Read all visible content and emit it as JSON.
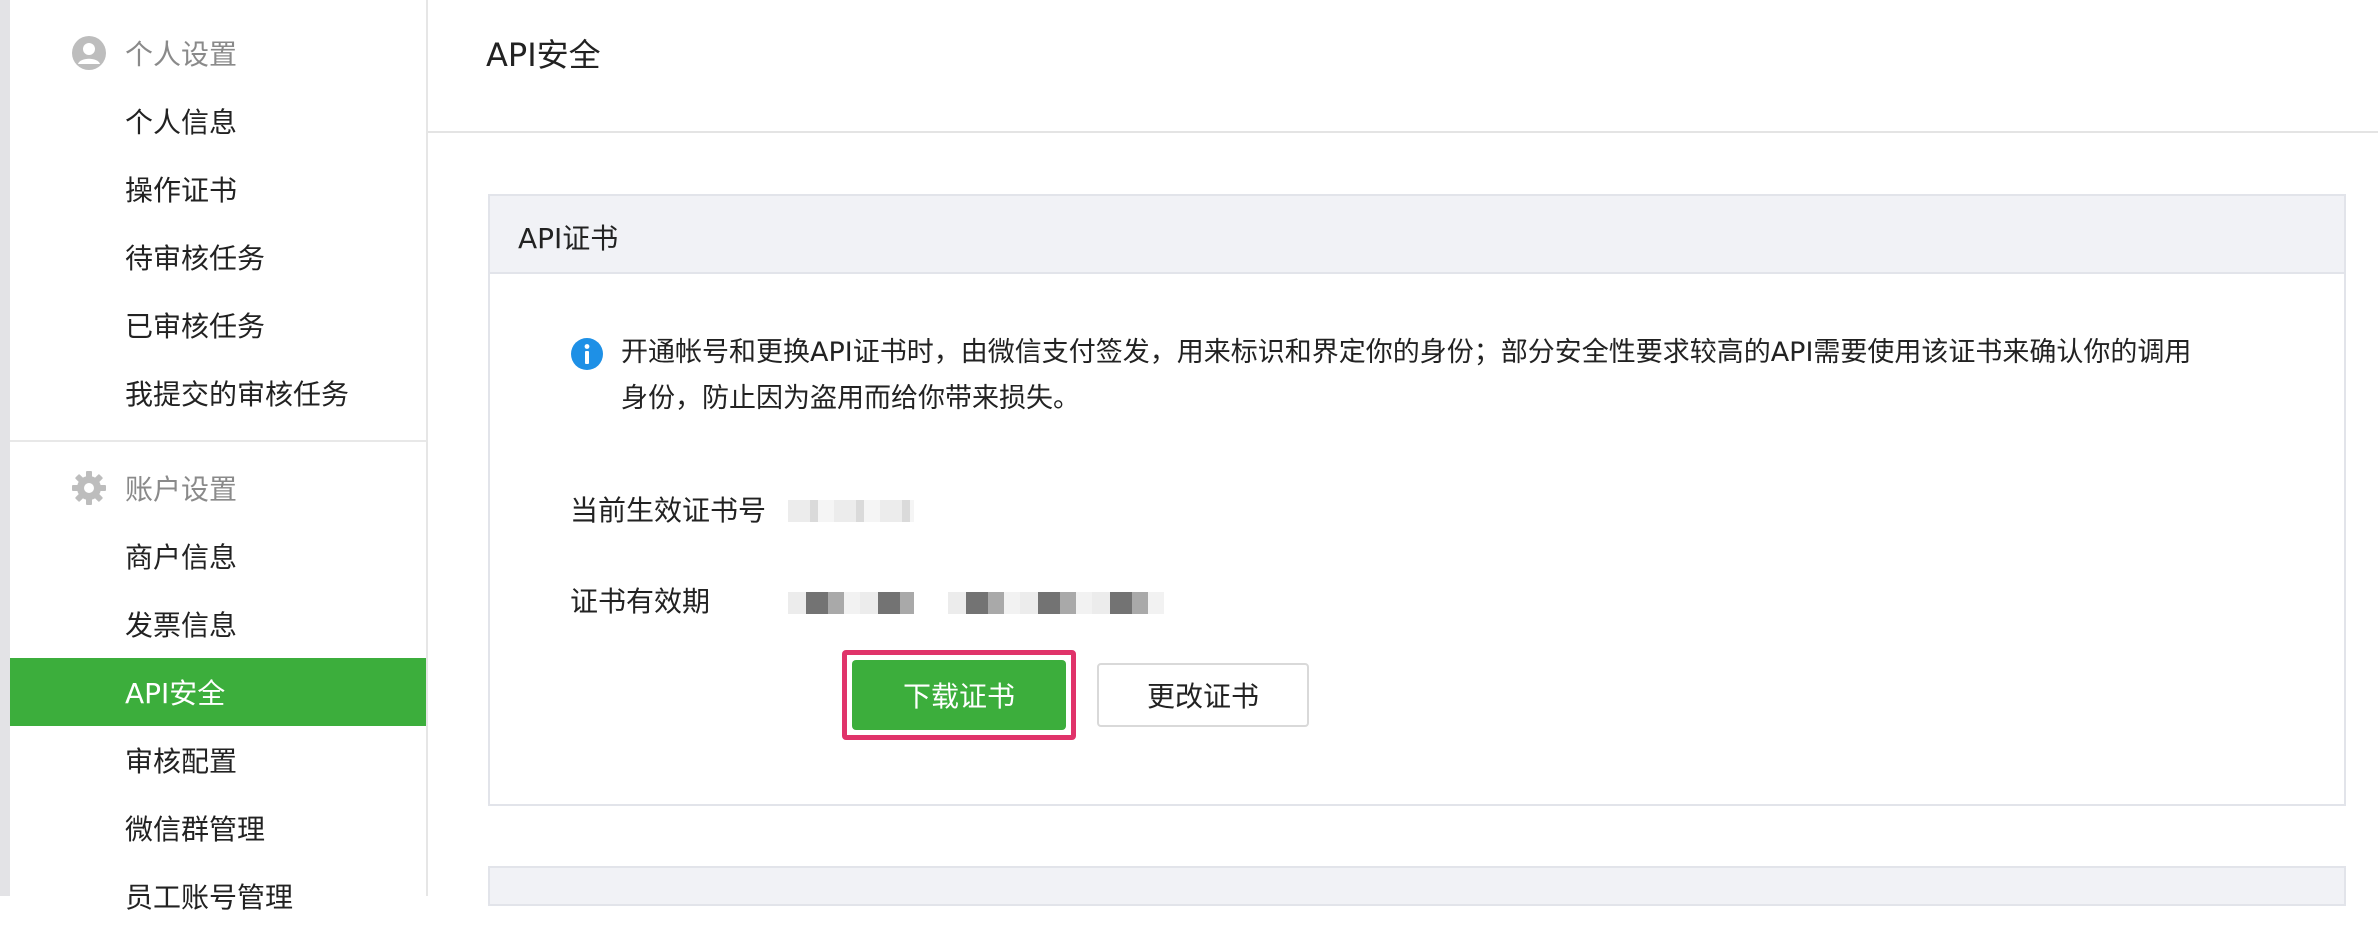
{
  "sidebar": {
    "groups": [
      {
        "icon": "user-icon",
        "label": "个人设置",
        "items": [
          {
            "label": "个人信息"
          },
          {
            "label": "操作证书"
          },
          {
            "label": "待审核任务"
          },
          {
            "label": "已审核任务"
          },
          {
            "label": "我提交的审核任务"
          }
        ]
      },
      {
        "icon": "gear-icon",
        "label": "账户设置",
        "items": [
          {
            "label": "商户信息"
          },
          {
            "label": "发票信息"
          },
          {
            "label": "API安全",
            "active": true
          },
          {
            "label": "审核配置"
          },
          {
            "label": "微信群管理"
          },
          {
            "label": "员工账号管理"
          }
        ]
      }
    ]
  },
  "main": {
    "page_title": "API安全",
    "card": {
      "title": "API证书",
      "info_icon": "info-icon",
      "info_line1": "开通帐号和更换API证书时，由微信支付签发，用来标识和界定你的身份；部分安全性要求较高的API需要使用该证书来确认你的调用",
      "info_line2": "身份，防止因为盗用而给你带来损失。",
      "fields": [
        {
          "label": "当前生效证书号"
        },
        {
          "label": "证书有效期"
        }
      ],
      "buttons": {
        "download": "下载证书",
        "change": "更改证书"
      }
    }
  },
  "colors": {
    "accent": "#3cae3c",
    "highlight": "#e0336a",
    "info": "#1e90e6"
  }
}
